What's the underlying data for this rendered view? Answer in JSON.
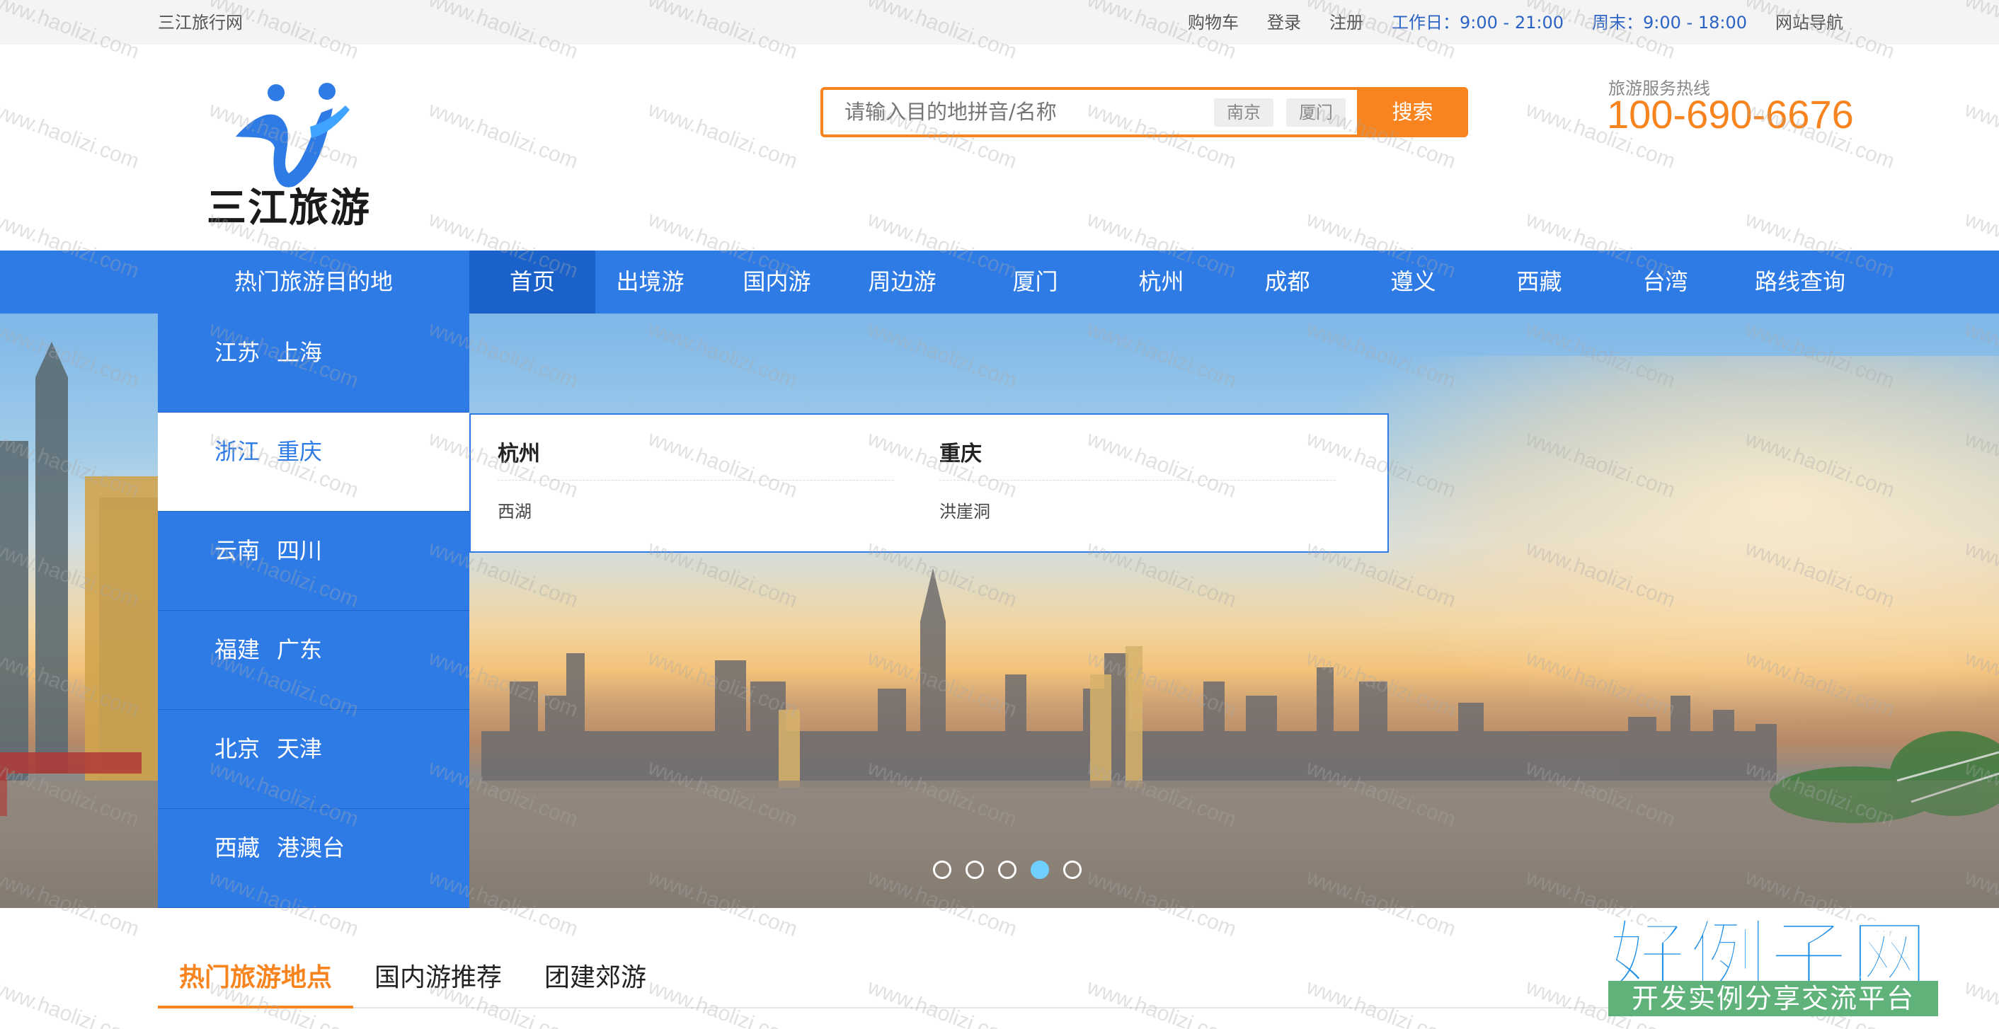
{
  "topbar": {
    "site_name": "三江旅行网",
    "cart": "购物车",
    "login": "登录",
    "register": "注册",
    "workday_hours": "工作日：9:00 - 21:00",
    "weekend_hours": "周末：9:00 - 18:00",
    "site_nav": "网站导航"
  },
  "header": {
    "logo_text": "三江旅游",
    "search_placeholder": "请输入目的地拼音/名称",
    "city_chips": [
      "南京",
      "厦门"
    ],
    "search_button": "搜索",
    "hotline_label": "旅游服务热线",
    "hotline_number": "100-690-6676"
  },
  "nav": {
    "hot_destinations": "热门旅游目的地",
    "items": [
      "首页",
      "出境游",
      "国内游",
      "周边游",
      "厦门",
      "杭州",
      "成都",
      "遵义",
      "西藏",
      "台湾",
      "路线查询"
    ],
    "active_index": 0
  },
  "side_menu": {
    "items": [
      {
        "a": "江苏",
        "b": "上海"
      },
      {
        "a": "浙江",
        "b": "重庆"
      },
      {
        "a": "云南",
        "b": "四川"
      },
      {
        "a": "福建",
        "b": "广东"
      },
      {
        "a": "北京",
        "b": "天津"
      },
      {
        "a": "西藏",
        "b": "港澳台"
      }
    ],
    "active_index": 1
  },
  "dropdown": {
    "columns": [
      {
        "title": "杭州",
        "links": [
          "西湖"
        ]
      },
      {
        "title": "重庆",
        "links": [
          "洪崖洞"
        ]
      }
    ]
  },
  "carousel": {
    "slide_count": 5,
    "active_index": 3
  },
  "tabs": {
    "items": [
      "热门旅游地点",
      "国内游推荐",
      "团建郊游"
    ],
    "active_index": 0
  },
  "watermark": {
    "text": "www.haolizi.com",
    "badge_title": "好例子网",
    "badge_subtitle": "开发实例分享交流平台"
  },
  "colors": {
    "brand_blue": "#2e7be6",
    "accent_orange": "#f7841e"
  }
}
